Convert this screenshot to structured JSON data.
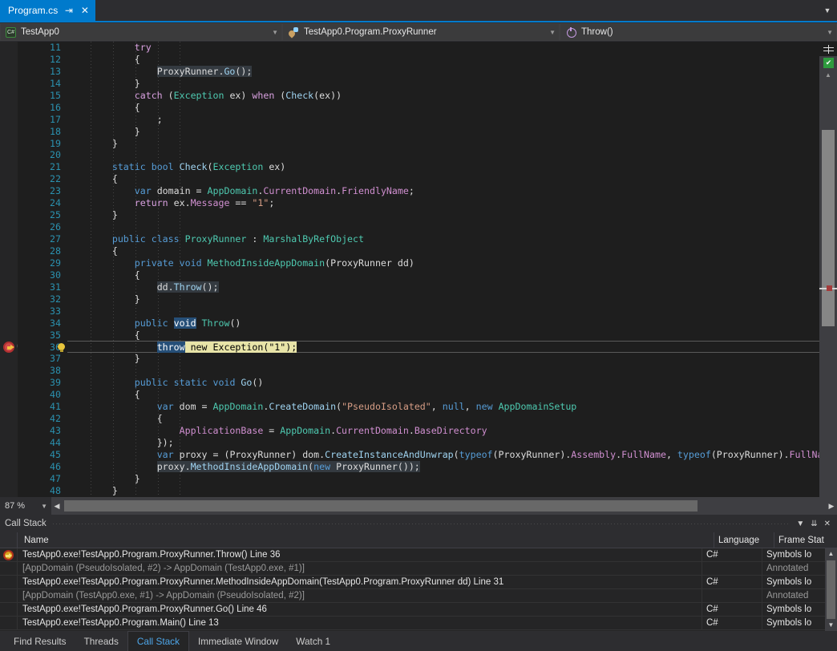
{
  "tab": {
    "title": "Program.cs",
    "pin_icon": "pin-icon",
    "close_icon": "close-icon",
    "overflow_icon": "chevron-down-icon"
  },
  "navbar": {
    "project": "TestApp0",
    "type": "TestApp0.Program.ProxyRunner",
    "member": "Throw()"
  },
  "editor": {
    "zoom": "87 %",
    "first_line": 11,
    "lines": [
      {
        "n": 11,
        "indent": 3,
        "tokens": [
          {
            "t": "try",
            "c": "ctl"
          }
        ]
      },
      {
        "n": 12,
        "indent": 3,
        "tokens": [
          {
            "t": "{",
            "c": "punct"
          }
        ]
      },
      {
        "n": 13,
        "indent": 4,
        "tokens": [
          {
            "t": "ProxyRunner",
            "c": "pln",
            "hl": "ref"
          },
          {
            "t": ".",
            "c": "punct",
            "hl": "ref"
          },
          {
            "t": "Go",
            "c": "mth",
            "hl": "ref"
          },
          {
            "t": "();",
            "c": "punct",
            "hl": "ref"
          }
        ]
      },
      {
        "n": 14,
        "indent": 3,
        "tokens": [
          {
            "t": "}",
            "c": "punct"
          }
        ]
      },
      {
        "n": 15,
        "indent": 3,
        "tokens": [
          {
            "t": "catch",
            "c": "ctl"
          },
          {
            "t": " (",
            "c": "punct"
          },
          {
            "t": "Exception",
            "c": "typ"
          },
          {
            "t": " ex) ",
            "c": "pln"
          },
          {
            "t": "when",
            "c": "ctl"
          },
          {
            "t": " (",
            "c": "punct"
          },
          {
            "t": "Check",
            "c": "mth"
          },
          {
            "t": "(ex))",
            "c": "punct"
          }
        ]
      },
      {
        "n": 16,
        "indent": 3,
        "tokens": [
          {
            "t": "{",
            "c": "punct"
          }
        ]
      },
      {
        "n": 17,
        "indent": 4,
        "tokens": [
          {
            "t": ";",
            "c": "punct"
          }
        ]
      },
      {
        "n": 18,
        "indent": 3,
        "tokens": [
          {
            "t": "}",
            "c": "punct"
          }
        ]
      },
      {
        "n": 19,
        "indent": 2,
        "tokens": [
          {
            "t": "}",
            "c": "punct"
          }
        ]
      },
      {
        "n": 20,
        "indent": 0,
        "tokens": []
      },
      {
        "n": 21,
        "indent": 2,
        "tokens": [
          {
            "t": "static",
            "c": "kw"
          },
          {
            "t": " ",
            "c": "pln"
          },
          {
            "t": "bool",
            "c": "kw"
          },
          {
            "t": " ",
            "c": "pln"
          },
          {
            "t": "Check",
            "c": "mth"
          },
          {
            "t": "(",
            "c": "punct"
          },
          {
            "t": "Exception",
            "c": "typ"
          },
          {
            "t": " ex)",
            "c": "pln"
          }
        ]
      },
      {
        "n": 22,
        "indent": 2,
        "tokens": [
          {
            "t": "{",
            "c": "punct"
          }
        ]
      },
      {
        "n": 23,
        "indent": 3,
        "tokens": [
          {
            "t": "var",
            "c": "kw"
          },
          {
            "t": " domain = ",
            "c": "pln"
          },
          {
            "t": "AppDomain",
            "c": "typ"
          },
          {
            "t": ".",
            "c": "punct"
          },
          {
            "t": "CurrentDomain",
            "c": "prop"
          },
          {
            "t": ".",
            "c": "punct"
          },
          {
            "t": "FriendlyName",
            "c": "prop"
          },
          {
            "t": ";",
            "c": "punct"
          }
        ]
      },
      {
        "n": 24,
        "indent": 3,
        "tokens": [
          {
            "t": "return",
            "c": "ctl"
          },
          {
            "t": " ex.",
            "c": "pln"
          },
          {
            "t": "Message",
            "c": "prop"
          },
          {
            "t": " == ",
            "c": "punct"
          },
          {
            "t": "\"1\"",
            "c": "str"
          },
          {
            "t": ";",
            "c": "punct"
          }
        ]
      },
      {
        "n": 25,
        "indent": 2,
        "tokens": [
          {
            "t": "}",
            "c": "punct"
          }
        ]
      },
      {
        "n": 26,
        "indent": 0,
        "tokens": []
      },
      {
        "n": 27,
        "indent": 2,
        "tokens": [
          {
            "t": "public",
            "c": "kw"
          },
          {
            "t": " ",
            "c": "pln"
          },
          {
            "t": "class",
            "c": "kw"
          },
          {
            "t": " ",
            "c": "pln"
          },
          {
            "t": "ProxyRunner",
            "c": "typ"
          },
          {
            "t": " : ",
            "c": "punct"
          },
          {
            "t": "MarshalByRefObject",
            "c": "typ"
          }
        ]
      },
      {
        "n": 28,
        "indent": 2,
        "tokens": [
          {
            "t": "{",
            "c": "punct"
          }
        ]
      },
      {
        "n": 29,
        "indent": 3,
        "tokens": [
          {
            "t": "private",
            "c": "kw"
          },
          {
            "t": " ",
            "c": "pln"
          },
          {
            "t": "void",
            "c": "kw"
          },
          {
            "t": " ",
            "c": "pln"
          },
          {
            "t": "MethodInsideAppDomain",
            "c": "typ"
          },
          {
            "t": "(",
            "c": "punct"
          },
          {
            "t": "ProxyRunner",
            "c": "pln"
          },
          {
            "t": " dd)",
            "c": "pln"
          }
        ]
      },
      {
        "n": 30,
        "indent": 3,
        "tokens": [
          {
            "t": "{",
            "c": "punct"
          }
        ]
      },
      {
        "n": 31,
        "indent": 4,
        "tokens": [
          {
            "t": "dd.",
            "c": "pln",
            "hl": "ref"
          },
          {
            "t": "Throw",
            "c": "mth",
            "hl": "ref"
          },
          {
            "t": "();",
            "c": "punct",
            "hl": "ref"
          }
        ]
      },
      {
        "n": 32,
        "indent": 3,
        "tokens": [
          {
            "t": "}",
            "c": "punct"
          }
        ]
      },
      {
        "n": 33,
        "indent": 0,
        "tokens": []
      },
      {
        "n": 34,
        "indent": 3,
        "tokens": [
          {
            "t": "public",
            "c": "kw"
          },
          {
            "t": " ",
            "c": "pln"
          },
          {
            "t": "void",
            "c": "kw",
            "hl": "blue"
          },
          {
            "t": " ",
            "c": "pln"
          },
          {
            "t": "Throw",
            "c": "typ"
          },
          {
            "t": "()",
            "c": "punct"
          }
        ]
      },
      {
        "n": 35,
        "indent": 3,
        "tokens": [
          {
            "t": "{",
            "c": "punct"
          }
        ]
      },
      {
        "n": 36,
        "indent": 4,
        "current": true,
        "tokens": [
          {
            "t": "throw",
            "c": "kw",
            "hl": "blue"
          },
          {
            "t": " new ",
            "c": "kw",
            "hl": "yellow"
          },
          {
            "t": "Exception(",
            "c": "pln",
            "hl": "yellow"
          },
          {
            "t": "\"1\"",
            "c": "str",
            "hl": "yellow"
          },
          {
            "t": ");",
            "c": "punct",
            "hl": "yellow"
          }
        ]
      },
      {
        "n": 37,
        "indent": 3,
        "tokens": [
          {
            "t": "}",
            "c": "punct"
          }
        ]
      },
      {
        "n": 38,
        "indent": 0,
        "tokens": []
      },
      {
        "n": 39,
        "indent": 3,
        "tokens": [
          {
            "t": "public",
            "c": "kw"
          },
          {
            "t": " ",
            "c": "pln"
          },
          {
            "t": "static",
            "c": "kw"
          },
          {
            "t": " ",
            "c": "pln"
          },
          {
            "t": "void",
            "c": "kw"
          },
          {
            "t": " ",
            "c": "pln"
          },
          {
            "t": "Go",
            "c": "mth"
          },
          {
            "t": "()",
            "c": "punct"
          }
        ]
      },
      {
        "n": 40,
        "indent": 3,
        "tokens": [
          {
            "t": "{",
            "c": "punct"
          }
        ]
      },
      {
        "n": 41,
        "indent": 4,
        "tokens": [
          {
            "t": "var",
            "c": "kw"
          },
          {
            "t": " dom = ",
            "c": "pln"
          },
          {
            "t": "AppDomain",
            "c": "typ"
          },
          {
            "t": ".",
            "c": "punct"
          },
          {
            "t": "CreateDomain",
            "c": "mth"
          },
          {
            "t": "(",
            "c": "punct"
          },
          {
            "t": "\"PseudoIsolated\"",
            "c": "str"
          },
          {
            "t": ", ",
            "c": "punct"
          },
          {
            "t": "null",
            "c": "kw"
          },
          {
            "t": ", ",
            "c": "punct"
          },
          {
            "t": "new",
            "c": "kw"
          },
          {
            "t": " ",
            "c": "pln"
          },
          {
            "t": "AppDomainSetup",
            "c": "typ"
          }
        ]
      },
      {
        "n": 42,
        "indent": 4,
        "tokens": [
          {
            "t": "{",
            "c": "punct"
          }
        ]
      },
      {
        "n": 43,
        "indent": 5,
        "tokens": [
          {
            "t": "ApplicationBase",
            "c": "prop"
          },
          {
            "t": " = ",
            "c": "punct"
          },
          {
            "t": "AppDomain",
            "c": "typ"
          },
          {
            "t": ".",
            "c": "punct"
          },
          {
            "t": "CurrentDomain",
            "c": "prop"
          },
          {
            "t": ".",
            "c": "punct"
          },
          {
            "t": "BaseDirectory",
            "c": "prop"
          }
        ]
      },
      {
        "n": 44,
        "indent": 4,
        "tokens": [
          {
            "t": "});",
            "c": "punct"
          }
        ]
      },
      {
        "n": 45,
        "indent": 4,
        "tokens": [
          {
            "t": "var",
            "c": "kw"
          },
          {
            "t": " proxy = (",
            "c": "pln"
          },
          {
            "t": "ProxyRunner",
            "c": "pln"
          },
          {
            "t": ") dom.",
            "c": "pln"
          },
          {
            "t": "CreateInstanceAndUnwrap",
            "c": "mth"
          },
          {
            "t": "(",
            "c": "punct"
          },
          {
            "t": "typeof",
            "c": "kw"
          },
          {
            "t": "(",
            "c": "punct"
          },
          {
            "t": "ProxyRunner",
            "c": "pln"
          },
          {
            "t": ").",
            "c": "punct"
          },
          {
            "t": "Assembly",
            "c": "prop"
          },
          {
            "t": ".",
            "c": "punct"
          },
          {
            "t": "FullName",
            "c": "prop"
          },
          {
            "t": ", ",
            "c": "punct"
          },
          {
            "t": "typeof",
            "c": "kw"
          },
          {
            "t": "(",
            "c": "punct"
          },
          {
            "t": "ProxyRunner",
            "c": "pln"
          },
          {
            "t": ").",
            "c": "punct"
          },
          {
            "t": "FullName",
            "c": "prop"
          },
          {
            "t": ");",
            "c": "punct"
          }
        ]
      },
      {
        "n": 46,
        "indent": 4,
        "tokens": [
          {
            "t": "proxy.",
            "c": "pln",
            "hl": "ref"
          },
          {
            "t": "MethodInsideAppDomain",
            "c": "mth",
            "hl": "ref"
          },
          {
            "t": "(",
            "c": "punct",
            "hl": "ref"
          },
          {
            "t": "new",
            "c": "kw",
            "hl": "ref"
          },
          {
            "t": " ProxyRunner());",
            "c": "pln",
            "hl": "ref"
          }
        ]
      },
      {
        "n": 47,
        "indent": 3,
        "tokens": [
          {
            "t": "}",
            "c": "punct"
          }
        ]
      },
      {
        "n": 48,
        "indent": 2,
        "tokens": [
          {
            "t": "}",
            "c": "punct"
          }
        ]
      }
    ],
    "breakpoint_line": 36,
    "breakpoint_icon": "breakpoint-icon",
    "current_statement_icon": "current-statement-arrow-icon",
    "lightbulb_icon": "lightbulb-icon",
    "split_icon": "split-window-icon",
    "health_icon": "code-health-ok-icon",
    "scroll_up_icon": "chevron-up-icon",
    "scroll_left_icon": "chevron-left-icon",
    "scroll_right_icon": "chevron-right-icon",
    "zoom_caret_icon": "chevron-down-icon"
  },
  "callstack": {
    "title": "Call Stack",
    "tool_icons": [
      "chevron-down-icon",
      "pin-icon",
      "close-icon"
    ],
    "columns": [
      "Name",
      "Language",
      "Frame Stat"
    ],
    "rows": [
      {
        "icon": "current-frame-icon",
        "name": "TestApp0.exe!TestApp0.Program.ProxyRunner.Throw() Line 36",
        "language": "C#",
        "state": "Symbols lo",
        "annotated": false
      },
      {
        "icon": "",
        "name": "[AppDomain (PseudoIsolated, #2) -> AppDomain (TestApp0.exe, #1)]",
        "language": "",
        "state": "Annotated",
        "annotated": true
      },
      {
        "icon": "",
        "name": "TestApp0.exe!TestApp0.Program.ProxyRunner.MethodInsideAppDomain(TestApp0.Program.ProxyRunner dd) Line 31",
        "language": "C#",
        "state": "Symbols lo",
        "annotated": false
      },
      {
        "icon": "",
        "name": "[AppDomain (TestApp0.exe, #1) -> AppDomain (PseudoIsolated, #2)]",
        "language": "",
        "state": "Annotated",
        "annotated": true
      },
      {
        "icon": "",
        "name": "TestApp0.exe!TestApp0.Program.ProxyRunner.Go() Line 46",
        "language": "C#",
        "state": "Symbols lo",
        "annotated": false
      },
      {
        "icon": "",
        "name": "TestApp0.exe!TestApp0.Program.Main() Line 13",
        "language": "C#",
        "state": "Symbols lo",
        "annotated": false
      }
    ]
  },
  "bottom_tabs": [
    {
      "label": "Find Results",
      "active": false
    },
    {
      "label": "Threads",
      "active": false
    },
    {
      "label": "Call Stack",
      "active": true
    },
    {
      "label": "Immediate Window",
      "active": false
    },
    {
      "label": "Watch 1",
      "active": false
    }
  ],
  "colors": {
    "accent": "#007acc",
    "editor_bg": "#1e1e1e",
    "chrome_bg": "#2d2d30",
    "current_line": "#e8e4a8",
    "selection": "#264f78",
    "breakpoint": "#d14a4a"
  }
}
